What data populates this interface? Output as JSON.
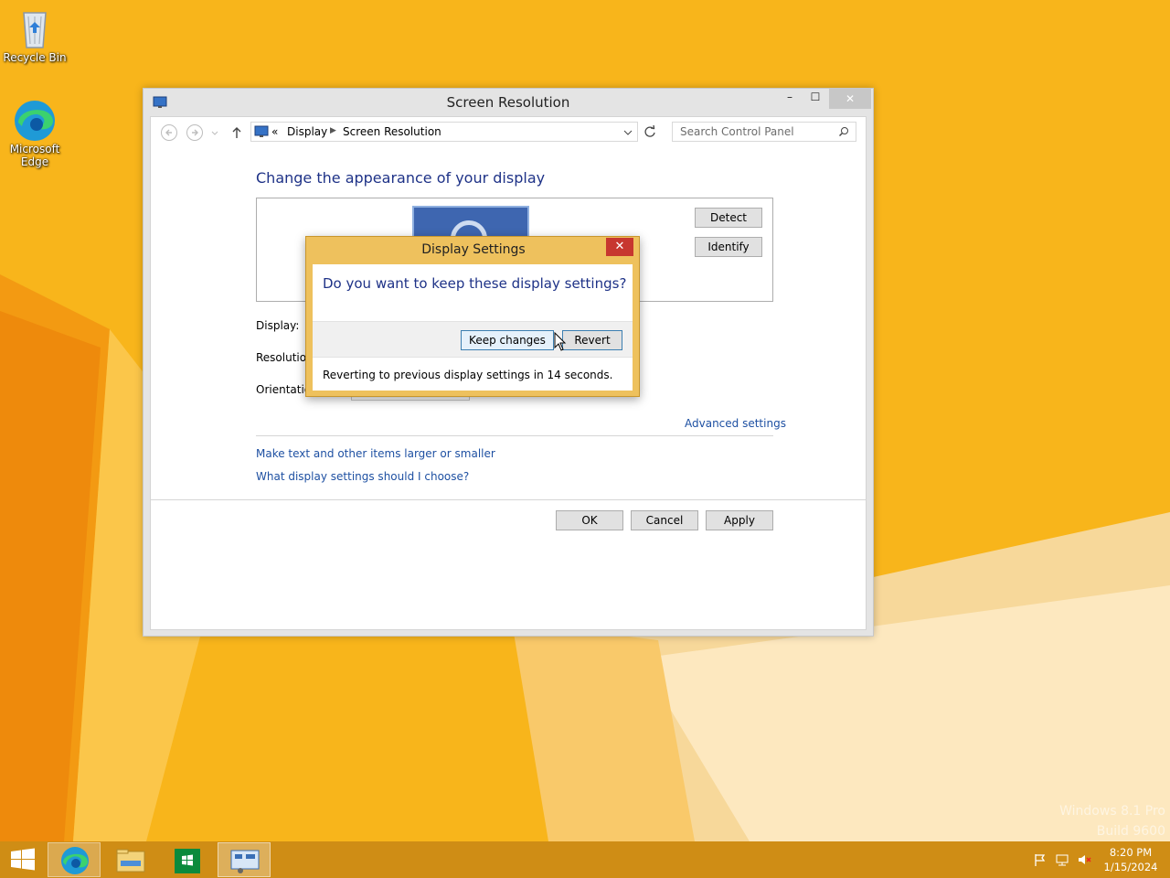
{
  "desktop": {
    "icons": [
      {
        "label": "Recycle Bin",
        "icon": "recycle-bin-icon"
      },
      {
        "label": "Microsoft Edge",
        "icon": "edge-icon"
      }
    ],
    "watermark_line1": "Windows 8.1 Pro",
    "watermark_line2": "Build 9600"
  },
  "window": {
    "title": "Screen Resolution",
    "minimize_glyph": "–",
    "maximize_glyph": "☐",
    "close_glyph": "✕",
    "breadcrumb": {
      "overflow": "«",
      "items": [
        "Display",
        "Screen Resolution"
      ]
    },
    "search_placeholder": "Search Control Panel",
    "heading": "Change the appearance of your display",
    "detect_label": "Detect",
    "identify_label": "Identify",
    "fields": {
      "display_label": "Display:",
      "resolution_label": "Resolution:",
      "orientation_label": "Orientation:"
    },
    "links": {
      "advanced": "Advanced settings",
      "text_size": "Make text and other items larger or smaller",
      "help": "What display settings should I choose?"
    },
    "buttons": {
      "ok": "OK",
      "cancel": "Cancel",
      "apply": "Apply"
    }
  },
  "dialog": {
    "title": "Display Settings",
    "close_glyph": "✕",
    "question": "Do you want to keep these display settings?",
    "keep_label": "Keep changes",
    "revert_label": "Revert",
    "status": "Reverting to previous display settings in 14 seconds."
  },
  "taskbar": {
    "items": [
      "start-button",
      "edge-icon",
      "file-explorer-icon",
      "store-icon",
      "control-panel-icon"
    ],
    "time": "8:20 PM",
    "date": "1/15/2024"
  },
  "colors": {
    "wallpaper": "#f7b21a",
    "dialog_frame": "#eec15d",
    "heading": "#1e3287",
    "link": "#1e50a2",
    "close_red": "#c7372f"
  }
}
